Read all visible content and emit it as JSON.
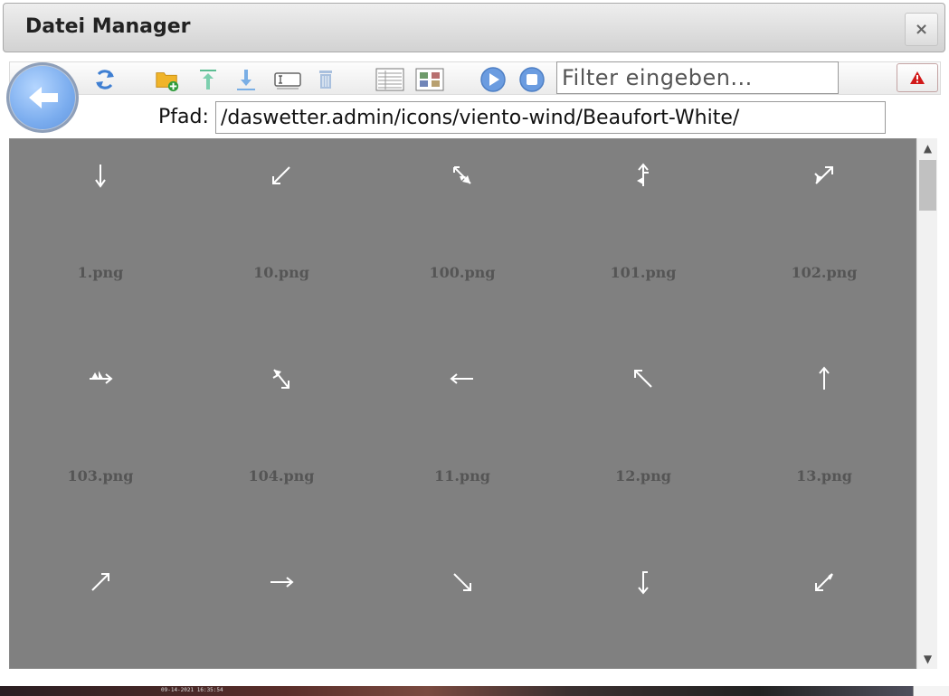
{
  "dialog": {
    "title": "Datei Manager",
    "close_label": "×"
  },
  "toolbar": {
    "filter_placeholder": "Filter eingeben...",
    "path_label": "Pfad:",
    "path_value": "/daswetter.admin/icons/viento-wind/Beaufort-White/"
  },
  "files": [
    {
      "name": "1.png",
      "icon": "arrow-down"
    },
    {
      "name": "10.png",
      "icon": "arrow-down-left"
    },
    {
      "name": "100.png",
      "icon": "wind-barb-se"
    },
    {
      "name": "101.png",
      "icon": "wind-barb-up"
    },
    {
      "name": "102.png",
      "icon": "wind-barb-ne"
    },
    {
      "name": "103.png",
      "icon": "wind-barb-right"
    },
    {
      "name": "104.png",
      "icon": "wind-barb-sw"
    },
    {
      "name": "11.png",
      "icon": "arrow-left"
    },
    {
      "name": "12.png",
      "icon": "arrow-up-left"
    },
    {
      "name": "13.png",
      "icon": "arrow-up"
    },
    {
      "name": "",
      "icon": "arrow-up-right"
    },
    {
      "name": "",
      "icon": "arrow-right"
    },
    {
      "name": "",
      "icon": "arrow-down-right"
    },
    {
      "name": "",
      "icon": "wind-barb-down"
    },
    {
      "name": "",
      "icon": "wind-barb-sw2"
    }
  ],
  "background": {
    "timestamp": "09-14-2021 16:35:54"
  }
}
